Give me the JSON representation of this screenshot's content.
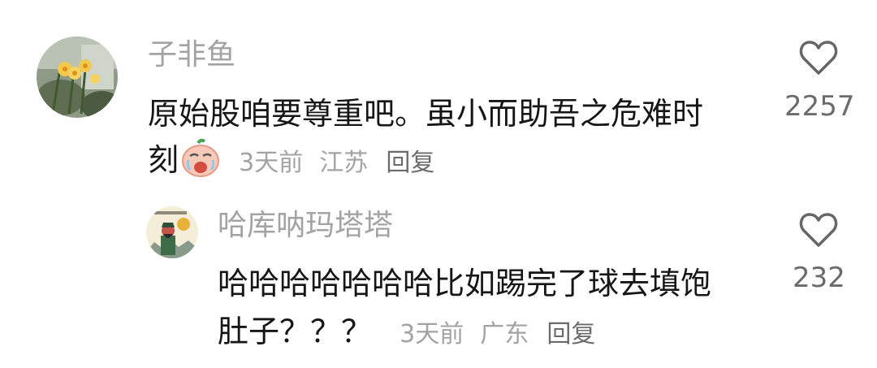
{
  "comments": [
    {
      "username": "子非鱼",
      "text_line1": "原始股咱要尊重吧。虽小而助吾之危难时",
      "text_line2": "刻",
      "emoji": "crying-face-emoji",
      "time": "3天前",
      "location": "江苏",
      "reply_label": "回复",
      "likes": "2257",
      "icons": {
        "like": "heart-outline-icon",
        "avatar": "flower-photo-avatar"
      }
    },
    {
      "username": "哈库呐玛塔塔",
      "text_line1": "哈哈哈哈哈哈哈比如踢完了球去填饱",
      "text_line2": "肚子？？？",
      "time": "3天前",
      "location": "广东",
      "reply_label": "回复",
      "likes": "232",
      "icons": {
        "like": "heart-outline-icon",
        "avatar": "guan-yu-cartoon-avatar"
      }
    }
  ],
  "colors": {
    "text": "#161616",
    "meta": "#a3a3a3",
    "count": "#6b6b6b",
    "heart": "#666666"
  }
}
